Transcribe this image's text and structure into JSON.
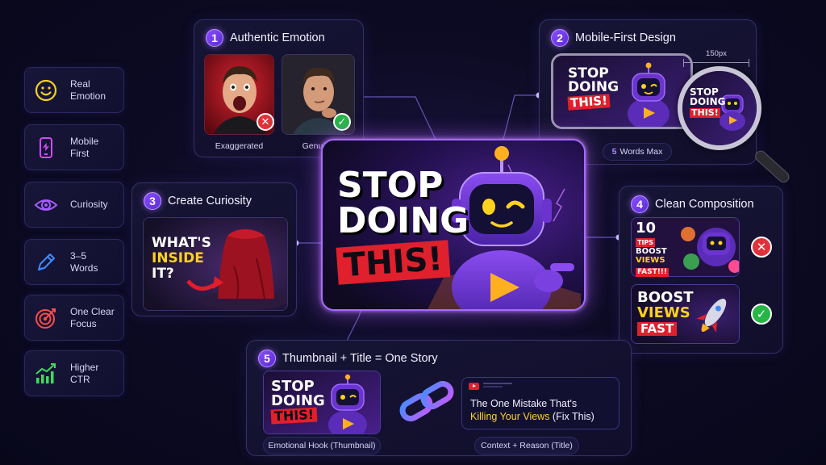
{
  "sidebar": {
    "items": [
      {
        "icon": "smiley-icon",
        "label_1": "Real",
        "label_2": "Emotion",
        "color": "#f3d321"
      },
      {
        "icon": "mobile-phone-icon",
        "label_1": "Mobile",
        "label_2": "First",
        "color": "#d24cf2"
      },
      {
        "icon": "eye-icon",
        "label_1": "Curiosity",
        "label_2": "",
        "color": "#a65cff"
      },
      {
        "icon": "pencil-icon",
        "label_1": "3–5",
        "label_2": "Words",
        "color": "#3f8cff"
      },
      {
        "icon": "target-icon",
        "label_1": "One Clear",
        "label_2": "Focus",
        "color": "#ff4b4b"
      },
      {
        "icon": "growth-chart-icon",
        "label_1": "Higher",
        "label_2": "CTR",
        "color": "#3ddc5c"
      }
    ]
  },
  "main_thumbnail": {
    "line1": "STOP",
    "line2": "DOING",
    "line3": "THIS!"
  },
  "panel1": {
    "number": "1",
    "title": "Authentic Emotion",
    "left_caption": "Exaggerated",
    "right_caption": "Genuine"
  },
  "panel2": {
    "number": "2",
    "title": "Mobile-First Design",
    "measure_label": "150px",
    "pill_number": "5",
    "pill_text": "Words Max"
  },
  "panel3": {
    "number": "3",
    "title": "Create Curiosity",
    "line1": "WHAT'S",
    "line2": "INSIDE",
    "line3": "IT?"
  },
  "panel4": {
    "number": "4",
    "title": "Clean Composition",
    "bad_big": "10",
    "bad_tips": "TIPS",
    "bad_line1": "BOOST",
    "bad_line2": "VIEWS",
    "bad_line3": "FAST!!!",
    "good_line1": "BOOST",
    "good_line2": "VIEWS",
    "good_line3": "FAST"
  },
  "panel5": {
    "number": "5",
    "title": "Thumbnail + Title = One Story",
    "title_part1": "The One Mistake That's",
    "title_highlight": "Killing Your Views",
    "title_part2": " (Fix This)",
    "left_pill": "Emotional Hook (Thumbnail)",
    "right_pill": "Context + Reason (Title)"
  },
  "colors": {
    "accent_purple": "#8a4dff",
    "highlight_yellow": "#ffd21c",
    "stamp_red": "#e0202c",
    "good_green": "#27b546",
    "bad_red": "#e2313a"
  }
}
